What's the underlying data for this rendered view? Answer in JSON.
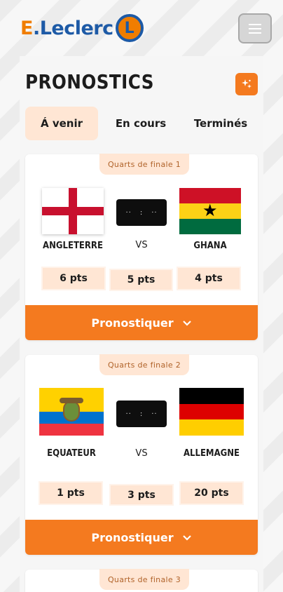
{
  "brand": {
    "logo_text": "E.Leclerc",
    "logo_letter": "L",
    "accent_color": "#f47a1f",
    "blue": "#1d5aa6"
  },
  "header": {
    "menu_icon": "hamburger-icon"
  },
  "page": {
    "title": "PRONOSTICS",
    "action_icon": "sparkle-icon"
  },
  "tabs": [
    {
      "label": "Á venir",
      "active": true
    },
    {
      "label": "En cours",
      "active": false
    },
    {
      "label": "Terminés",
      "active": false
    }
  ],
  "matches": [
    {
      "label": "Quarts de finale 1",
      "home": "ANGLETERRE",
      "away": "GHANA",
      "vs": "VS",
      "score_placeholder": [
        "··",
        ":",
        "··"
      ],
      "points": [
        "6 pts",
        "5 pts",
        "4 pts"
      ],
      "cta": "Pronostiquer"
    },
    {
      "label": "Quarts de finale 2",
      "home": "EQUATEUR",
      "away": "ALLEMAGNE",
      "vs": "VS",
      "score_placeholder": [
        "··",
        ":",
        "··"
      ],
      "points": [
        "1 pts",
        "3 pts",
        "20 pts"
      ],
      "cta": "Pronostiquer"
    },
    {
      "label": "Quarts de finale 3"
    }
  ]
}
